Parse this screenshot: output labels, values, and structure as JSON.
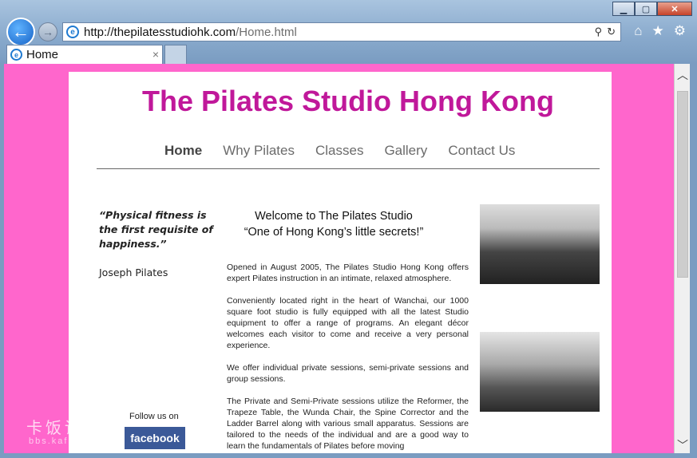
{
  "browser": {
    "url_host": "http://thepilatesstudiohk.com",
    "url_path": "/Home.html",
    "tab_title": "Home",
    "tab_close": "×",
    "back_icon": "←",
    "forward_icon": "→",
    "min_icon": "▁",
    "max_icon": "▢",
    "close_icon": "✕",
    "search_icon": "⚲",
    "refresh_icon": "↻",
    "home_icon": "⌂",
    "favorites_icon": "★",
    "tools_icon": "⚙",
    "scroll_up": "︿",
    "scroll_down": "﹀"
  },
  "site": {
    "title": "The Pilates Studio Hong Kong",
    "nav": [
      "Home",
      "Why Pilates",
      "Classes",
      "Gallery",
      "Contact Us"
    ],
    "quote": "“Physical fitness is the first requisite of happiness.”",
    "quote_author": "Joseph Pilates",
    "welcome_line1": "Welcome to The Pilates Studio",
    "welcome_line2": "“One of Hong Kong’s little secrets!”",
    "paragraphs": [
      "Opened in August 2005, The Pilates Studio Hong Kong offers expert Pilates instruction in an intimate, relaxed atmosphere.",
      "Conveniently located right in the heart of Wanchai, our 1000 square foot studio is fully equipped with all the latest Studio equipment to offer a range of programs. An elegant décor welcomes each visitor to come and receive a very personal experience.",
      "We offer individual private sessions, semi-private sessions and group sessions.",
      "The Private and Semi-Private sessions utilize the Reformer, the Trapeze Table, the Wunda Chair, the Spine Corrector and the Ladder Barrel along with various small apparatus. Sessions are tailored to the needs of the individual and are a good way to learn the fundamentals of Pilates before moving"
    ],
    "follow_label": "Follow us on",
    "facebook_label": "facebook"
  },
  "watermark": {
    "text": "卡饭论坛",
    "sub": "bbs.kafan.cn"
  },
  "colors": {
    "background": "#ff66cc",
    "title": "#c0189a",
    "facebook": "#3b5998"
  }
}
